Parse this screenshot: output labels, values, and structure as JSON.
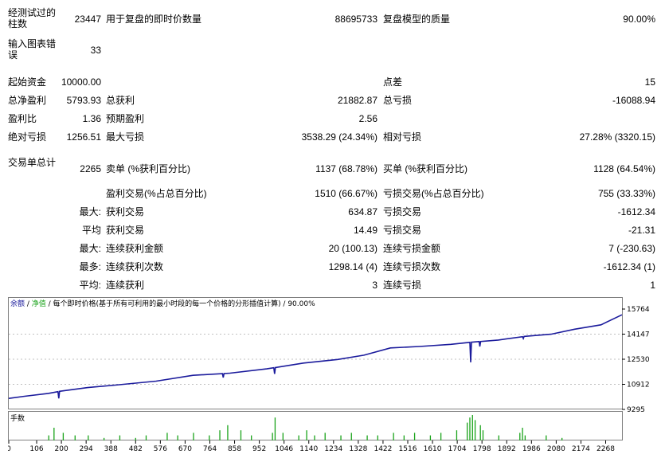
{
  "report": {
    "bars_label": "经测试过的柱数",
    "bars_value": "23447",
    "ticks_label": "用于复盘的即时价数量",
    "ticks_value": "88695733",
    "quality_label": "复盘模型的质量",
    "quality_value": "90.00%",
    "errors_label": "输入图表错误",
    "errors_value": "33",
    "deposit_label": "起始资金",
    "deposit_value": "10000.00",
    "spread_label": "点差",
    "spread_value": "15",
    "net_label": "总净盈利",
    "net_value": "5793.93",
    "gross_profit_label": "总获利",
    "gross_profit_value": "21882.87",
    "gross_loss_label": "总亏损",
    "gross_loss_value": "-16088.94",
    "pf_label": "盈利比",
    "pf_value": "1.36",
    "payoff_label": "预期盈利",
    "payoff_value": "2.56",
    "abs_dd_label": "绝对亏损",
    "abs_dd_value": "1256.51",
    "max_dd_label": "最大亏损",
    "max_dd_value": "3538.29 (24.34%)",
    "rel_dd_label": "相对亏损",
    "rel_dd_value": "27.28% (3320.15)",
    "total_trades_label": "交易单总计",
    "total_trades_value": "2265",
    "short_label": "卖单 (%获利百分比)",
    "short_value": "1137 (68.78%)",
    "long_label": "买单 (%获利百分比)",
    "long_value": "1128 (64.54%)",
    "profit_trades_label": "盈利交易(%占总百分比)",
    "profit_trades_value": "1510 (66.67%)",
    "loss_trades_label": "亏损交易(%占总百分比)",
    "loss_trades_value": "755 (33.33%)",
    "largest_prefix": "最大:",
    "largest_profit_label": "获利交易",
    "largest_profit_value": "634.87",
    "largest_loss_label": "亏损交易",
    "largest_loss_value": "-1612.34",
    "average_prefix": "平均",
    "avg_profit_label": "获利交易",
    "avg_profit_value": "14.49",
    "avg_loss_label": "亏损交易",
    "avg_loss_value": "-21.31",
    "max_prefix": "最大:",
    "max_cons_wins_label": "连续获利金额",
    "max_cons_wins_value": "20 (100.13)",
    "max_cons_losses_label": "连续亏损金额",
    "max_cons_losses_value": "7 (-230.63)",
    "maximal_prefix": "最多:",
    "maximal_cons_profit_label": "连续获利次数",
    "maximal_cons_profit_value": "1298.14 (4)",
    "maximal_cons_loss_label": "连续亏损次数",
    "maximal_cons_loss_value": "-1612.34 (1)",
    "avg_cons_prefix": "平均:",
    "avg_cons_wins_label": "连续获利",
    "avg_cons_wins_value": "3",
    "avg_cons_losses_label": "连续亏损",
    "avg_cons_losses_value": "1"
  },
  "chart_data": {
    "type": "line",
    "header": {
      "balance": "余额",
      "sep1": " / ",
      "equity": "净值",
      "rest": " / 每个即时价格(基于所有可利用的最小时段的每一个价格的分形插值计算) / 90.00%"
    },
    "volume_label": "手数",
    "y_ticks": [
      "15764",
      "14147",
      "12530",
      "10912",
      "9295"
    ],
    "ylim": [
      9295,
      16250
    ],
    "x_ticks": [
      "0",
      "106",
      "200",
      "294",
      "388",
      "482",
      "576",
      "670",
      "764",
      "858",
      "952",
      "1046",
      "1140",
      "1234",
      "1328",
      "1422",
      "1516",
      "1610",
      "1704",
      "1798",
      "1892",
      "1986",
      "2080",
      "2174",
      "2268"
    ],
    "xlim": [
      0,
      2330
    ],
    "balance_line": [
      [
        0,
        10000
      ],
      [
        60,
        10150
      ],
      [
        150,
        10350
      ],
      [
        195,
        10500
      ],
      [
        300,
        10750
      ],
      [
        420,
        10950
      ],
      [
        560,
        11200
      ],
      [
        700,
        11600
      ],
      [
        840,
        11750
      ],
      [
        980,
        12050
      ],
      [
        1120,
        12450
      ],
      [
        1250,
        12700
      ],
      [
        1350,
        13000
      ],
      [
        1450,
        13500
      ],
      [
        1560,
        13600
      ],
      [
        1680,
        13750
      ],
      [
        1760,
        13900
      ],
      [
        1860,
        14050
      ],
      [
        1960,
        14300
      ],
      [
        2060,
        14450
      ],
      [
        2150,
        14800
      ],
      [
        2250,
        15100
      ],
      [
        2330,
        15800
      ]
    ],
    "equity_dips": [
      {
        "x": 190,
        "y": 10000
      },
      {
        "x": 815,
        "y": 11450
      },
      {
        "x": 1010,
        "y": 11700
      },
      {
        "x": 1755,
        "y": 12500
      },
      {
        "x": 1790,
        "y": 13600
      },
      {
        "x": 1955,
        "y": 14150
      }
    ],
    "volume_bars": [
      [
        150,
        2
      ],
      [
        170,
        5
      ],
      [
        205,
        3
      ],
      [
        250,
        2
      ],
      [
        300,
        2
      ],
      [
        360,
        1
      ],
      [
        420,
        2
      ],
      [
        480,
        1
      ],
      [
        520,
        2
      ],
      [
        600,
        3
      ],
      [
        640,
        2
      ],
      [
        700,
        3
      ],
      [
        760,
        2
      ],
      [
        800,
        4
      ],
      [
        830,
        6
      ],
      [
        880,
        4
      ],
      [
        920,
        2
      ],
      [
        1000,
        3
      ],
      [
        1010,
        9
      ],
      [
        1040,
        3
      ],
      [
        1100,
        2
      ],
      [
        1130,
        4
      ],
      [
        1160,
        2
      ],
      [
        1200,
        3
      ],
      [
        1260,
        2
      ],
      [
        1300,
        3
      ],
      [
        1360,
        2
      ],
      [
        1400,
        2
      ],
      [
        1460,
        3
      ],
      [
        1500,
        2
      ],
      [
        1540,
        3
      ],
      [
        1600,
        2
      ],
      [
        1640,
        3
      ],
      [
        1700,
        4
      ],
      [
        1740,
        7
      ],
      [
        1750,
        9
      ],
      [
        1760,
        10
      ],
      [
        1770,
        8
      ],
      [
        1790,
        6
      ],
      [
        1800,
        4
      ],
      [
        1860,
        2
      ],
      [
        1940,
        3
      ],
      [
        1950,
        5
      ],
      [
        1960,
        2
      ],
      [
        2040,
        2
      ],
      [
        2100,
        1
      ]
    ],
    "volume_max": 10
  },
  "colors": {
    "balance": "#1b1b9c",
    "volume": "#1aa31a",
    "grid": "#c0c0c0",
    "frame": "#808080"
  }
}
